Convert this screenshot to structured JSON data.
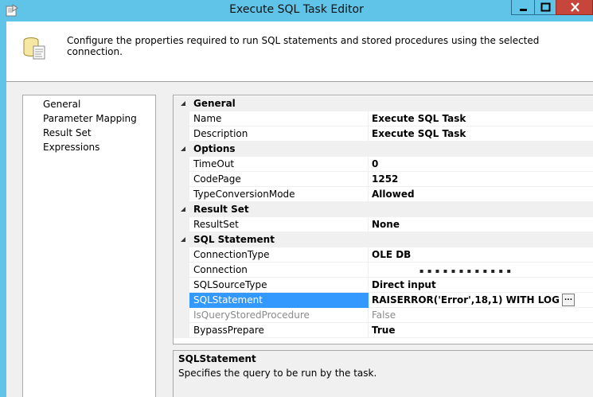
{
  "window": {
    "title": "Execute SQL Task Editor",
    "header_text": "Configure the properties required to run SQL statements and stored procedures using the selected connection."
  },
  "nav": {
    "items": [
      "General",
      "Parameter Mapping",
      "Result Set",
      "Expressions"
    ],
    "selected": "General"
  },
  "grid": {
    "categories": {
      "general": "General",
      "options": "Options",
      "result_set": "Result Set",
      "sql_statement": "SQL Statement"
    },
    "properties": {
      "name": {
        "name": "Name",
        "value": "Execute SQL Task"
      },
      "description": {
        "name": "Description",
        "value": "Execute SQL Task"
      },
      "timeout": {
        "name": "TimeOut",
        "value": "0"
      },
      "codepage": {
        "name": "CodePage",
        "value": "1252"
      },
      "typeconversionmode": {
        "name": "TypeConversionMode",
        "value": "Allowed"
      },
      "resultset": {
        "name": "ResultSet",
        "value": "None"
      },
      "connectiontype": {
        "name": "ConnectionType",
        "value": "OLE DB"
      },
      "connection": {
        "name": "Connection",
        "value": ""
      },
      "sqlsourcetype": {
        "name": "SQLSourceType",
        "value": "Direct input"
      },
      "sqlstatement": {
        "name": "SQLStatement",
        "value": "RAISERROR('Error',18,1) WITH LOG"
      },
      "isquerystoredprocedure": {
        "name": "IsQueryStoredProcedure",
        "value": "False"
      },
      "bypassprepare": {
        "name": "BypassPrepare",
        "value": "True"
      }
    },
    "selected_property": "SQLStatement",
    "ellipsis_label": "..."
  },
  "description": {
    "title": "SQLStatement",
    "text": "Specifies the query to be run by the task."
  },
  "colors": {
    "titlebar": "#60c3e8",
    "close_button": "#c7463c",
    "selection": "#3399ff",
    "panel": "#f0f0f0"
  },
  "icons": {
    "app": "sql-task-icon",
    "header": "database-script-icon",
    "collapse": "collapse-triangle-icon"
  }
}
